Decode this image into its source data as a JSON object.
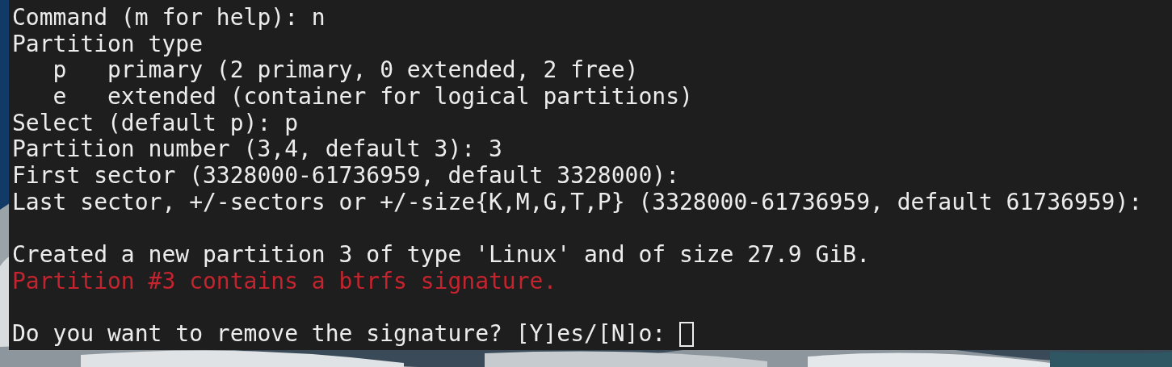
{
  "terminal": {
    "lines": [
      {
        "kind": "output",
        "text": "Command (m for help): n"
      },
      {
        "kind": "output",
        "text": "Partition type"
      },
      {
        "kind": "output",
        "text": "   p   primary (2 primary, 0 extended, 2 free)"
      },
      {
        "kind": "output",
        "text": "   e   extended (container for logical partitions)"
      },
      {
        "kind": "output",
        "text": "Select (default p): p"
      },
      {
        "kind": "output",
        "text": "Partition number (3,4, default 3): 3"
      },
      {
        "kind": "output",
        "text": "First sector (3328000-61736959, default 3328000):"
      },
      {
        "kind": "output",
        "text": "Last sector, +/-sectors or +/-size{K,M,G,T,P} (3328000-61736959, default 61736959):"
      },
      {
        "kind": "blank"
      },
      {
        "kind": "output",
        "text": "Created a new partition 3 of type 'Linux' and of size 27.9 GiB."
      },
      {
        "kind": "error",
        "text": "Partition #3 contains a btrfs signature."
      },
      {
        "kind": "blank"
      },
      {
        "kind": "prompt",
        "text": "Do you want to remove the signature? [Y]es/[N]o: "
      }
    ]
  }
}
